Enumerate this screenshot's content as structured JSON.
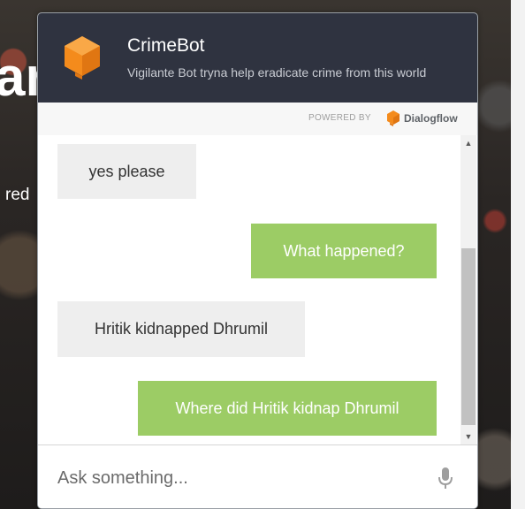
{
  "background": {
    "heading_fragment": "ar",
    "word_fragment": "red"
  },
  "chat": {
    "title": "CrimeBot",
    "subtitle": "Vigilante Bot tryna help eradicate crime from this world",
    "powered_by": "POWERED BY",
    "provider": "Dialogflow",
    "messages": [
      {
        "sender": "bot",
        "text": "yes please"
      },
      {
        "sender": "user",
        "text": "What happened?"
      },
      {
        "sender": "bot",
        "text": "Hritik kidnapped Dhrumil"
      },
      {
        "sender": "user",
        "text": "Where did Hritik kidnap Dhrumil"
      }
    ],
    "input_placeholder": "Ask something...",
    "icons": {
      "logo": "dialogflow-cube-icon",
      "provider_logo": "dialogflow-logo-icon",
      "mic": "microphone-icon",
      "scroll_up": "scroll-up-arrow-icon",
      "scroll_down": "scroll-down-arrow-icon"
    }
  },
  "colors": {
    "header_bg": "#2f3340",
    "bot_bubble": "#eeeeee",
    "user_bubble": "#9ccc65",
    "brand_orange": "#f48b1c"
  }
}
